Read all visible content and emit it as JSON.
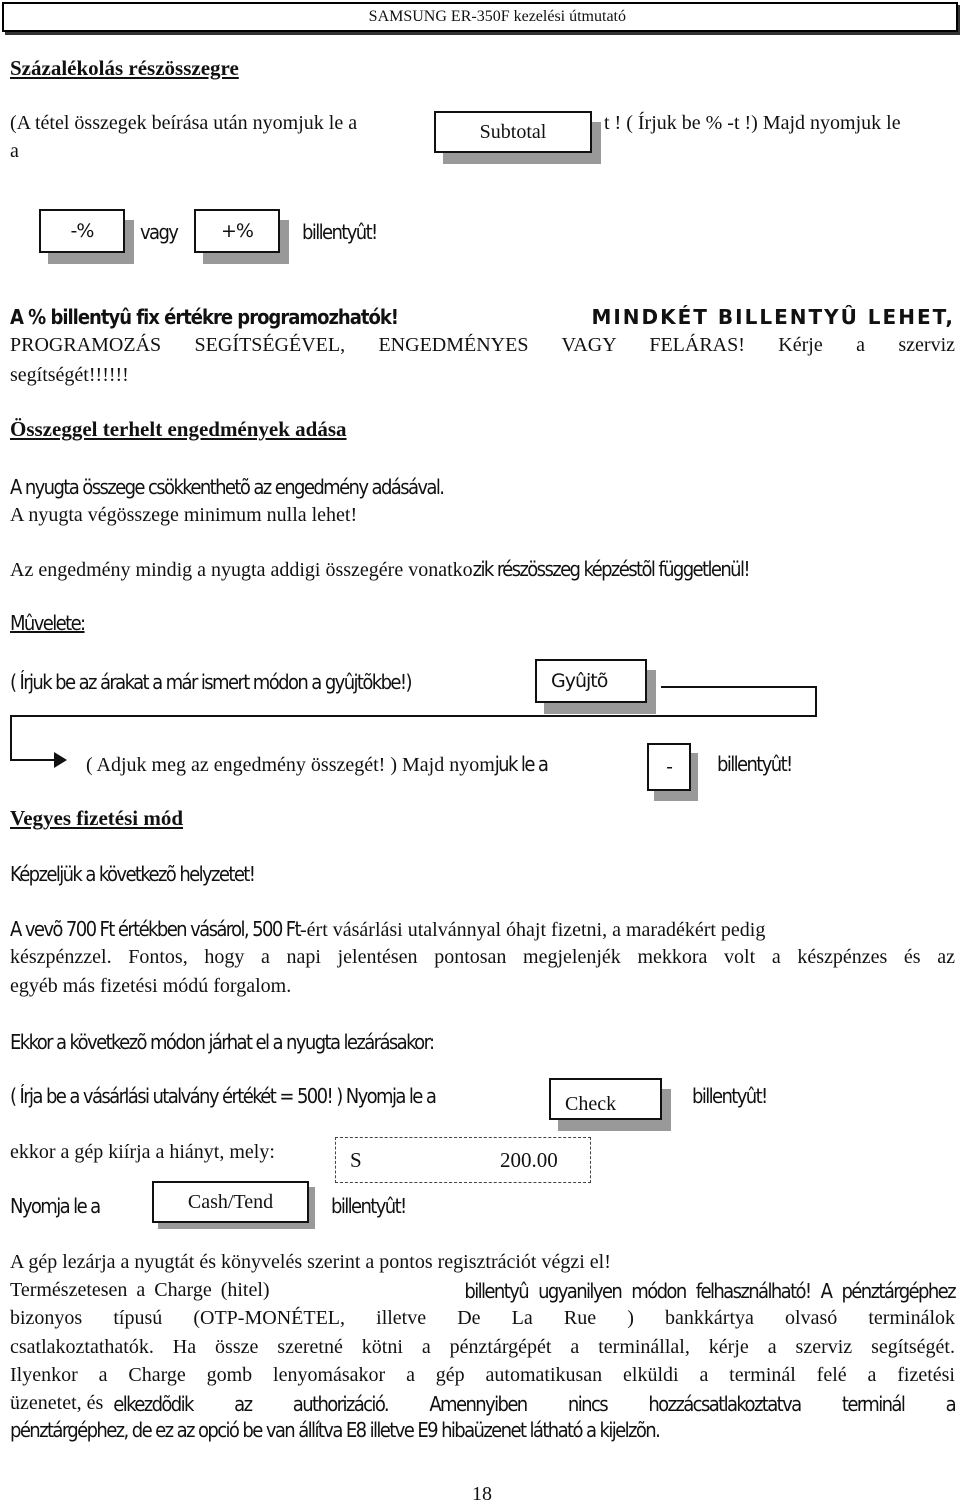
{
  "header": {
    "title": "SAMSUNG ER-350F kezelési útmutató"
  },
  "section1": {
    "heading": "Százalékolás részösszegre",
    "line1_pre": "(A tétel összegek beírása után nyomjuk le a",
    "subtotal_key": "Subtotal",
    "line1_post": "t ! ( Írjuk be % -t !) Majd nyomjuk le",
    "line1_wrap": "a",
    "minus_percent_key": "-%",
    "vagy": "vagy",
    "plus_percent_key": "+%",
    "billentyut": "billentyût!",
    "note_line1_a": "A % billentyû fix értékre programozhatók!",
    "note_line1_b": "MINDKÉT BILLENTYÛ LEHET,",
    "note_line2": "PROGRAMOZÁS SEGÍTSÉGÉVEL, ENGEDMÉNYES VAGY FELÁRAS! Kérje a szerviz",
    "note_line3": "segítségét!!!!!!"
  },
  "section2": {
    "heading": "Összeggel terhelt engedmények adása",
    "line1": "A nyugta összege csökkenthetõ az engedmény adásával.",
    "line2": "A nyugta végösszege minimum nulla lehet!",
    "line3_serif": "Az engedmény mindig a nyugta addigi összegére vonatko",
    "line3_sans": "zik részösszeg képzéstõl függetlenül!",
    "muvelete": "Mûvelete:",
    "step1": "( Írjuk be az árakat a már ismert módon a gyûjtõkbe!)",
    "gyujto_key": "Gyûjtõ",
    "step2_serif": "( Adjuk meg az engedmény összegét! ) Majd nyom",
    "step2_sans": "juk le a",
    "minus_key": "-",
    "step2_post": "billentyût!"
  },
  "section3": {
    "heading": "Vegyes fizetési mód",
    "intro": "Képzeljük a következõ helyzetet!",
    "para1_sans": "A vevõ 700 Ft értékben vásárol, 500 Ft",
    "para1_serif": "-ért vásárlási utalvánnyal óhajt fizetni, a maradékért pedig",
    "para1_line2": "készpénzzel. Fontos, hogy a napi jelentésen pontosan megjelenjék mekkora volt a készpénzes és az",
    "para1_line3": "egyéb más fizetési módú forgalom.",
    "procedure": "Ekkor a következõ módon járhat el a nyugta lezárásakor:",
    "step1_pre": "( Írja be a vásárlási utalvány értékét = 500! ) Nyomja le a",
    "check_key": "Check",
    "step1_post": "billentyût!",
    "step2_pre": "ekkor a gép kiírja a hiányt, mely:",
    "display": {
      "label": "S",
      "value": "200.00"
    },
    "step3_pre": "Nyomja le a",
    "cash_key": "Cash/Tend",
    "step3_post": "billentyût!",
    "close_line": "A gép lezárja a nyugtát és könyvelés szerint a pontos regisztrációt végzi el!",
    "charge_l1_serif": "Természetesen a Charge (hitel)",
    "charge_l1_sans": "billentyû ugyanilyen módon felhasználható! A pénztárgéphez",
    "charge_l2": "bizonyos típusú (OTP-MONÉTEL, illetve De La Rue ) bankkártya olvasó terminálok",
    "charge_l3": "csatlakoztathatók. Ha össze szeretné kötni a pénztárgépét a terminállal, kérje a szerviz segítségét.",
    "charge_l4": "Ilyenkor a Charge gomb lenyomásakor a gép automatikusan elküldi a terminál felé a fizetési",
    "charge_l5_serif": "üzenetet, és",
    "charge_l5_sans": "elkezdõdik az authorizáció. Amennyiben nincs hozzácsatlakoztatva terminál a",
    "charge_l6": "pénztárgéphez, de ez az opció be van állítva E8 illetve E9 hibaüzenet látható a kijelzõn."
  },
  "footer": {
    "page_number": "18"
  }
}
